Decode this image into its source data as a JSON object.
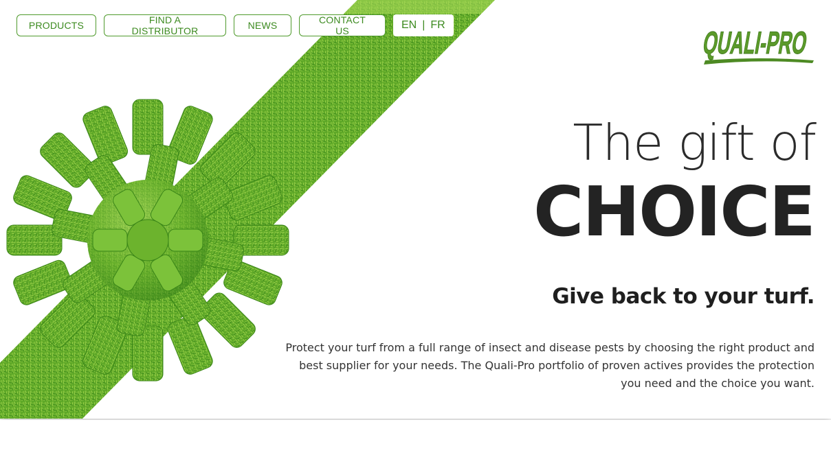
{
  "nav": {
    "products": "PRODUCTS",
    "distributor": "FIND A DISTRIBUTOR",
    "news": "NEWS",
    "contact": "CONTACT US"
  },
  "lang": {
    "en": "EN",
    "separator": "|",
    "fr": "FR"
  },
  "logo": {
    "text": "QUALI-PRO"
  },
  "hero": {
    "headline_line1": "The gift of",
    "headline_line2": "CHOICE",
    "subheadline": "Give back to your turf.",
    "body": "Protect your turf from a full range of insect and disease pests by choosing the right product and best supplier for your needs. The Quali-Pro portfolio of proven actives provides the protection you need and the choice you want."
  },
  "colors": {
    "brand_green": "#3c8a1f",
    "logo_green": "#5b9a2a",
    "grass_light": "#8cc63f",
    "grass_dark": "#2f7a16",
    "headline": "#232323"
  },
  "icons": {
    "grass_bow": "grass-bow-illustration"
  }
}
